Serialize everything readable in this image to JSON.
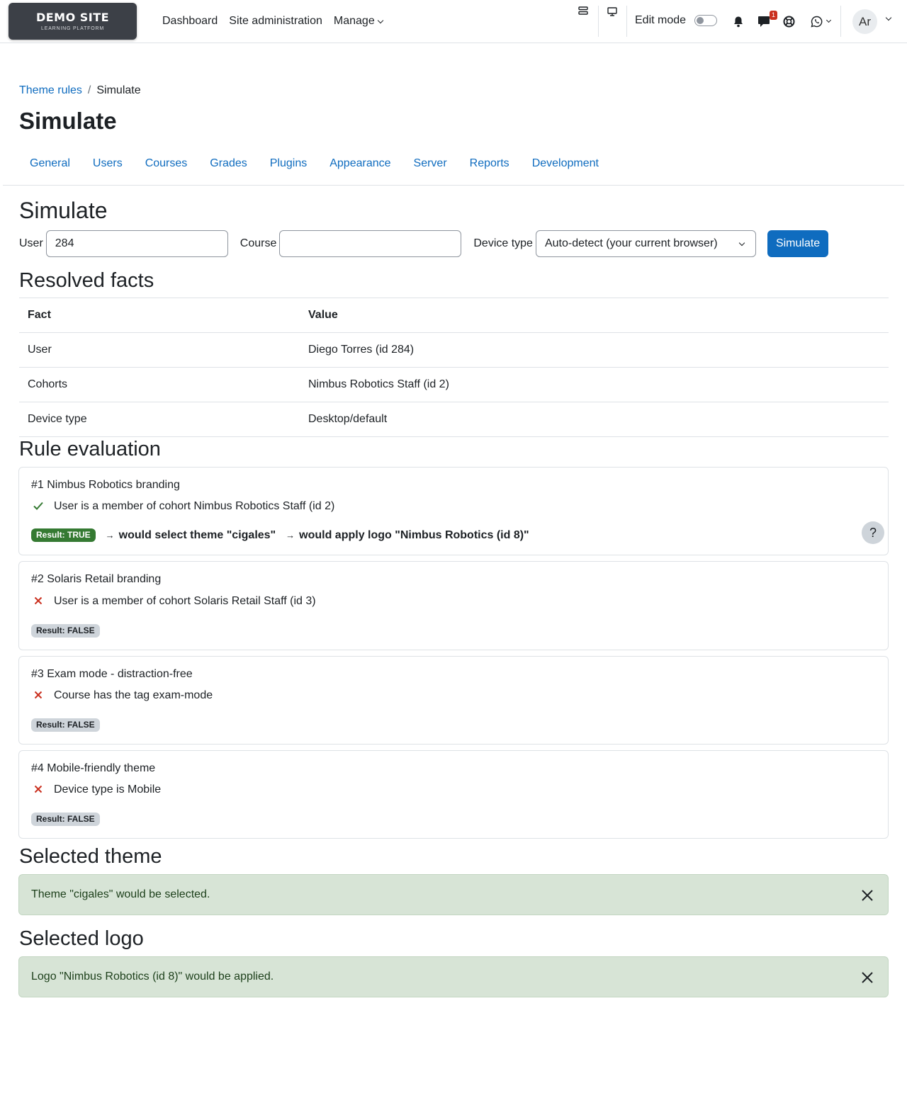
{
  "brand": {
    "name": "DEMO SITE",
    "tagline": "LEARNING PLATFORM"
  },
  "nav": {
    "links": [
      "Dashboard",
      "Site administration",
      "Manage"
    ],
    "edit_mode_label": "Edit mode",
    "edit_mode_on": false,
    "messages_count": "1",
    "avatar_initials": "Ar"
  },
  "breadcrumb": {
    "parent": "Theme rules",
    "separator": "/",
    "current": "Simulate"
  },
  "page_title": "Simulate",
  "tabs": [
    "General",
    "Users",
    "Courses",
    "Grades",
    "Plugins",
    "Appearance",
    "Server",
    "Reports",
    "Development"
  ],
  "simulate": {
    "heading": "Simulate",
    "user_label": "User",
    "user_value": "284",
    "course_label": "Course",
    "course_value": "",
    "device_label": "Device type",
    "device_value": "Auto-detect (your current browser)",
    "button": "Simulate"
  },
  "facts": {
    "heading": "Resolved facts",
    "columns": [
      "Fact",
      "Value"
    ],
    "rows": [
      [
        "User",
        "Diego Torres (id 284)"
      ],
      [
        "Cohorts",
        "Nimbus Robotics Staff (id 2)"
      ],
      [
        "Device type",
        "Desktop/default"
      ]
    ]
  },
  "evaluation": {
    "heading": "Rule evaluation",
    "rules": [
      {
        "title": "#1 Nimbus Robotics branding",
        "condition": "User is a member of cohort Nimbus Robotics Staff (id 2)",
        "passed": true,
        "result": "Result: TRUE",
        "arrow": "→",
        "outcome_theme": "would select theme \"cigales\"",
        "outcome_logo": "would apply logo \"Nimbus Robotics (id 8)\"",
        "help": "?"
      },
      {
        "title": "#2 Solaris Retail branding",
        "condition": "User is a member of cohort Solaris Retail Staff (id 3)",
        "passed": false,
        "result": "Result: FALSE"
      },
      {
        "title": "#3 Exam mode - distraction-free",
        "condition": "Course has the tag exam-mode",
        "passed": false,
        "result": "Result: FALSE"
      },
      {
        "title": "#4 Mobile-friendly theme",
        "condition": "Device type is Mobile",
        "passed": false,
        "result": "Result: FALSE"
      }
    ]
  },
  "selected_theme": {
    "heading": "Selected theme",
    "message": "Theme \"cigales\" would be selected."
  },
  "selected_logo": {
    "heading": "Selected logo",
    "message": "Logo \"Nimbus Robotics (id 8)\" would be applied."
  },
  "icons": {
    "check": "check-icon",
    "cross": "cross-icon",
    "close": "close-icon"
  },
  "colors": {
    "link": "#0f6cbf",
    "success": "#357a32",
    "danger": "#ca3120",
    "alert_bg": "#d7e4d6"
  }
}
